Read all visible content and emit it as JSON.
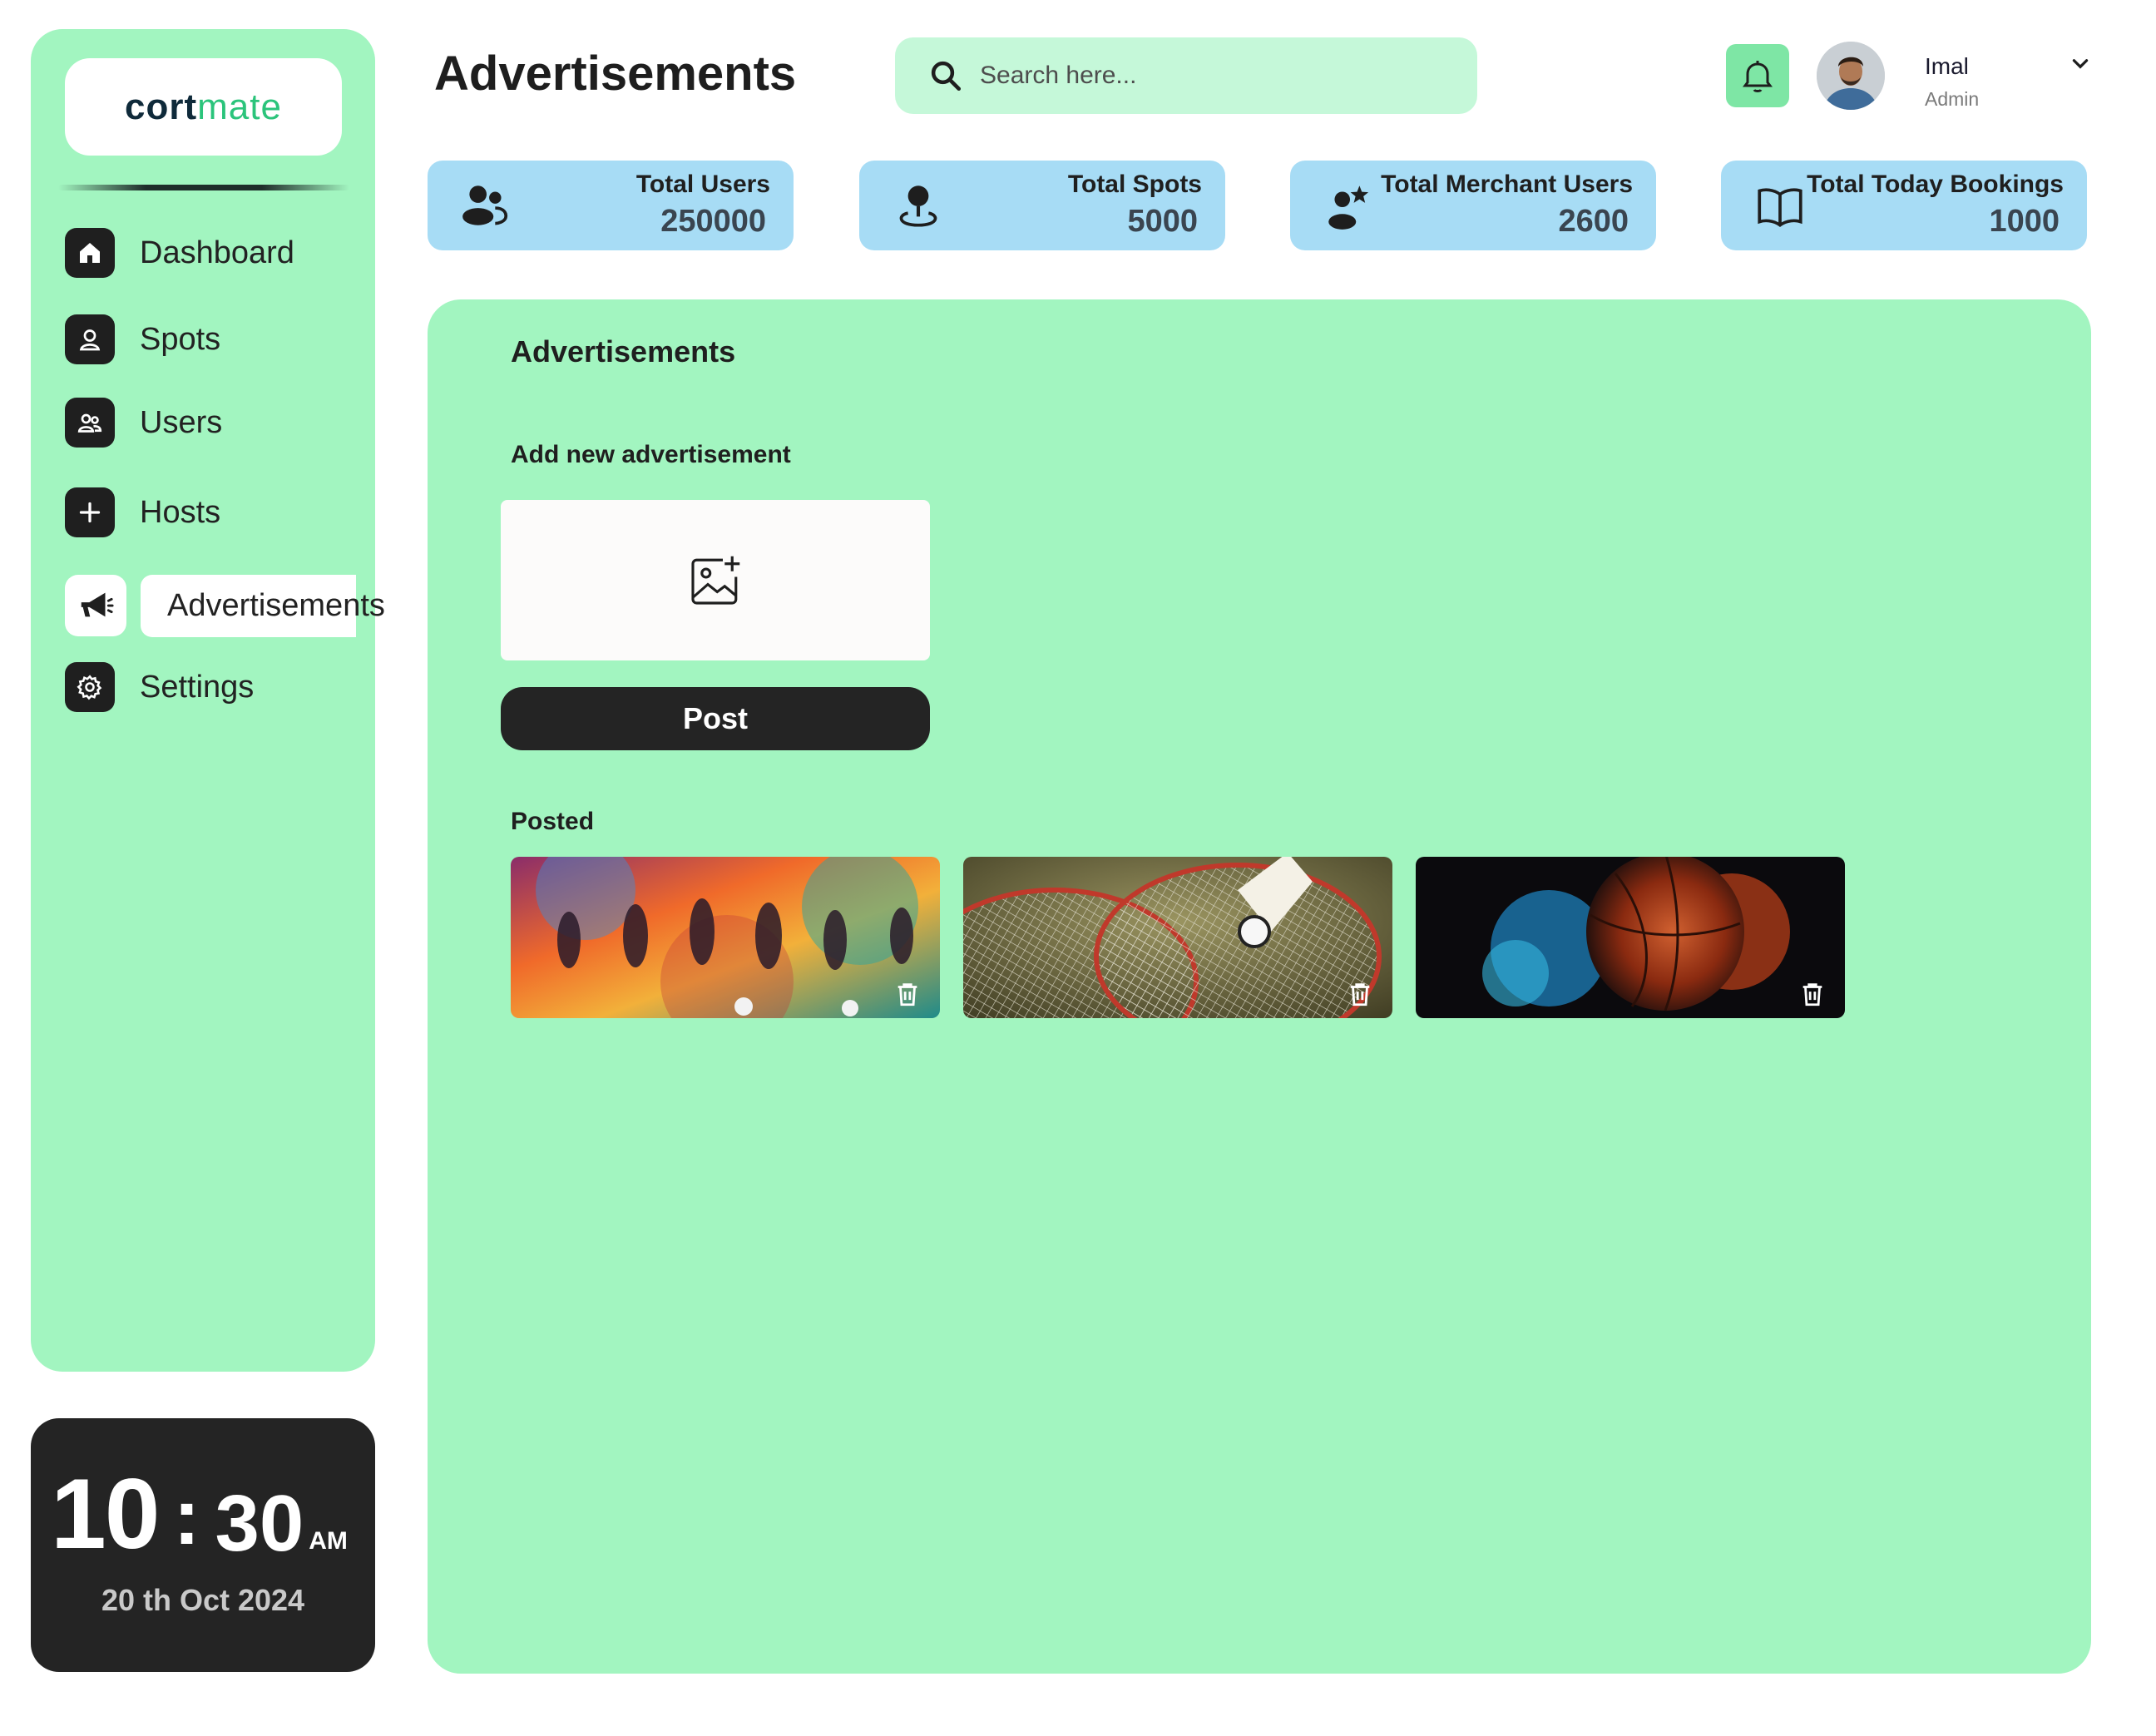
{
  "brand": {
    "part1": "cort",
    "part2": "mate"
  },
  "sidebar": {
    "items": [
      {
        "label": "Dashboard",
        "icon": "home-icon"
      },
      {
        "label": "Spots",
        "icon": "location-icon"
      },
      {
        "label": "Users",
        "icon": "users-icon"
      },
      {
        "label": "Hosts",
        "icon": "plus-icon"
      },
      {
        "label": "Advertisements",
        "icon": "megaphone-icon",
        "active": true
      },
      {
        "label": "Settings",
        "icon": "gear-icon"
      }
    ]
  },
  "clock": {
    "hour": "10",
    "colon": ":",
    "minute": "30",
    "ampm": "AM",
    "date": "20 th Oct 2024"
  },
  "header": {
    "title": "Advertisements",
    "search_placeholder": "Search here...",
    "user": {
      "name": "Imal",
      "role": "Admin"
    }
  },
  "stats": [
    {
      "label": "Total Users",
      "value": "250000",
      "icon": "users-icon"
    },
    {
      "label": "Total Spots",
      "value": "5000",
      "icon": "location-pin-icon"
    },
    {
      "label": "Total Merchant Users",
      "value": "2600",
      "icon": "merchant-star-icon"
    },
    {
      "label": "Total Today Bookings",
      "value": "1000",
      "icon": "book-icon"
    }
  ],
  "main": {
    "title": "Advertisements",
    "add_label": "Add new advertisement",
    "post_button": "Post",
    "posted_label": "Posted",
    "ads": [
      {
        "subject": "soccer players running",
        "icon": "trash-icon"
      },
      {
        "subject": "badminton rackets and shuttlecock",
        "icon": "trash-icon"
      },
      {
        "subject": "basketball with colored smoke",
        "icon": "trash-icon"
      }
    ]
  },
  "colors": {
    "mint": "#a2f5c0",
    "search_bg": "#c5f8d9",
    "stat_bg": "#a7dcf5",
    "dark": "#242424",
    "accent_green": "#2bc47b"
  }
}
